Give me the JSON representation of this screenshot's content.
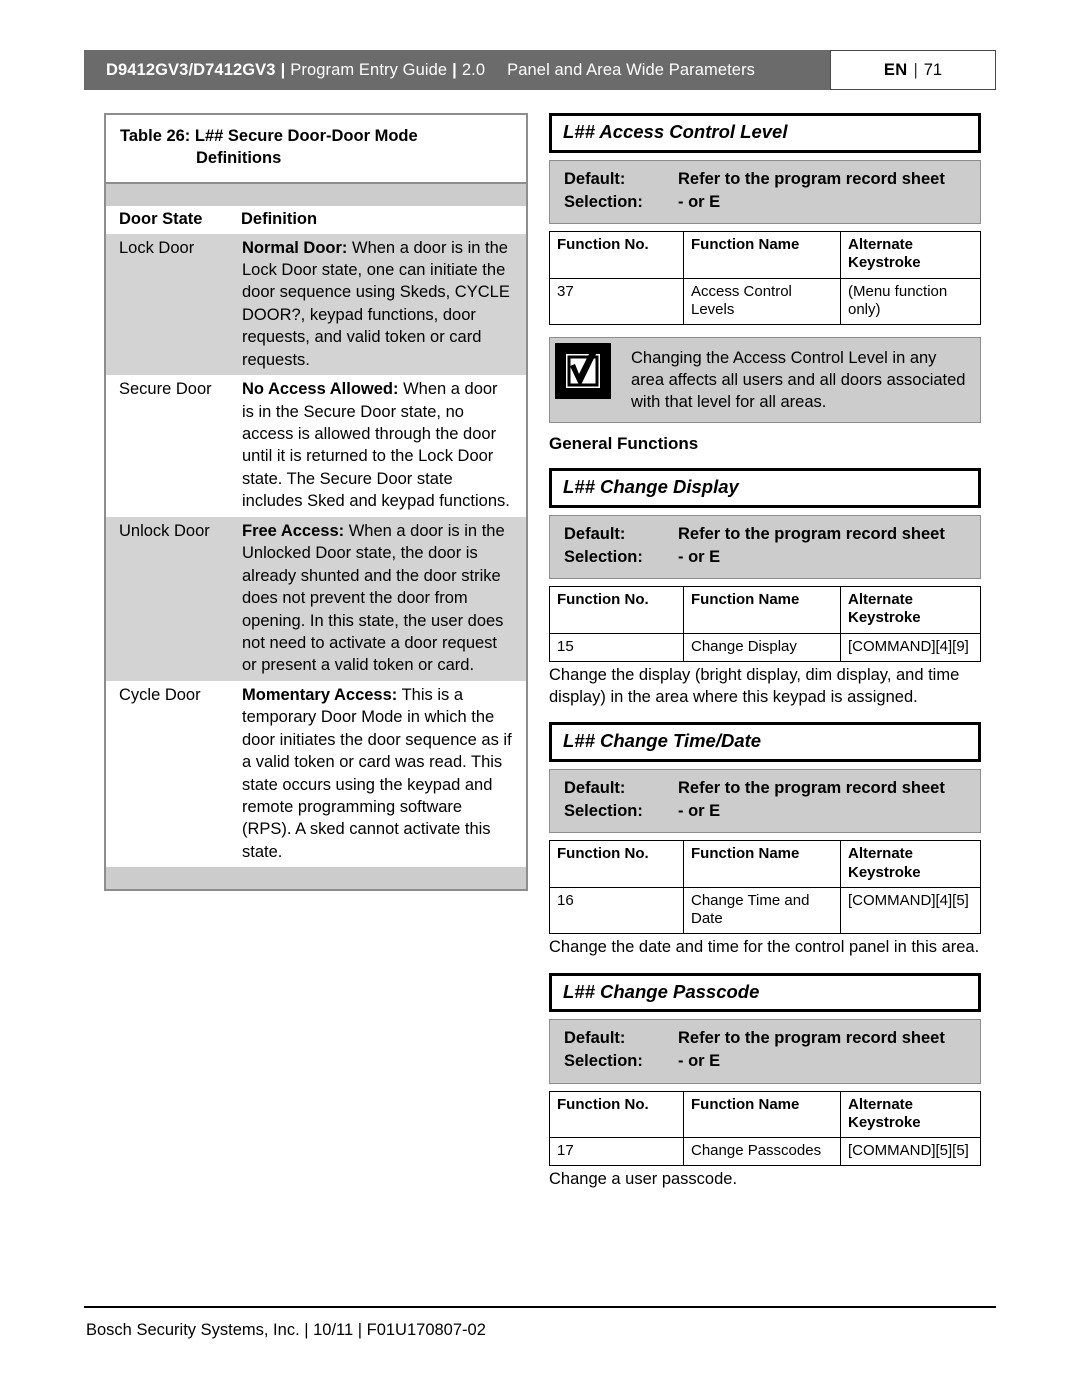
{
  "header": {
    "model": "D9412GV3/D7412GV3",
    "separator": "|",
    "guide": "Program Entry Guide",
    "version": "2.0",
    "chapter": "Panel and Area Wide Parameters",
    "lang_code": "EN",
    "lang_divider": "|",
    "page_number": "71",
    "bar_color": "#6b6b6b"
  },
  "left_table": {
    "caption_line1": "Table 26: L## Secure Door-Door Mode",
    "caption_line2": "Definitions",
    "columns": [
      "Door State",
      "Definition"
    ],
    "rows": [
      {
        "state": "Lock Door",
        "lead": "Normal Door:",
        "text": " When a door is in the Lock Door state, one can initiate the door sequence using Skeds, CYCLE DOOR?, keypad functions, door requests, and valid token or card requests.",
        "shaded": true
      },
      {
        "state": "Secure Door",
        "lead": "No Access Allowed:",
        "text": " When a door is in the Secure Door state, no access is allowed through the door until it is returned to the Lock Door state. The Secure Door state includes Sked and keypad functions.",
        "shaded": false
      },
      {
        "state": "Unlock Door",
        "lead": "Free Access:",
        "text": " When a door is in the Unlocked Door state, the door is already shunted and the door strike does not prevent the door from opening. In this state, the user does not need to activate a door request or present a valid token or card.",
        "shaded": true
      },
      {
        "state": "Cycle Door",
        "lead": "Momentary Access:",
        "text": " This is a temporary Door Mode in which the door initiates the door sequence as if a valid token or card was read. This state occurs using the keypad and remote programming software (RPS). A sked cannot activate this state.",
        "shaded": false
      }
    ]
  },
  "common": {
    "default_label": "Default:",
    "default_value": "Refer to the program record sheet",
    "selection_label": "Selection:",
    "selection_value": "- or E",
    "fn_col_no": "Function No.",
    "fn_col_name": "Function Name",
    "fn_col_keystroke": "Alternate Keystroke"
  },
  "sections": [
    {
      "title": "L## Access Control Level",
      "function_no": "37",
      "function_name": "Access Control Levels",
      "keystroke": "(Menu function only)",
      "description": ""
    },
    {
      "title": "L## Change Display",
      "function_no": "15",
      "function_name": "Change Display",
      "keystroke": "[COMMAND][4][9]",
      "description": "Change the display (bright display, dim display, and time display) in the area where this keypad is assigned."
    },
    {
      "title": "L## Change Time/Date",
      "function_no": "16",
      "function_name": "Change Time and Date",
      "keystroke": "[COMMAND][4][5]",
      "description": "Change the date and time for the control panel in this area."
    },
    {
      "title": "L## Change Passcode",
      "function_no": "17",
      "function_name": "Change Passcodes",
      "keystroke": "[COMMAND][5][5]",
      "description": "Change a user passcode."
    }
  ],
  "notice": {
    "icon": "checkbox-check-icon",
    "text": "Changing the Access Control Level in any area affects all users and all doors associated with that level for all areas."
  },
  "subheading": "General Functions",
  "footer": {
    "text": "Bosch Security Systems, Inc. | 10/11 | F01U170807-02"
  }
}
